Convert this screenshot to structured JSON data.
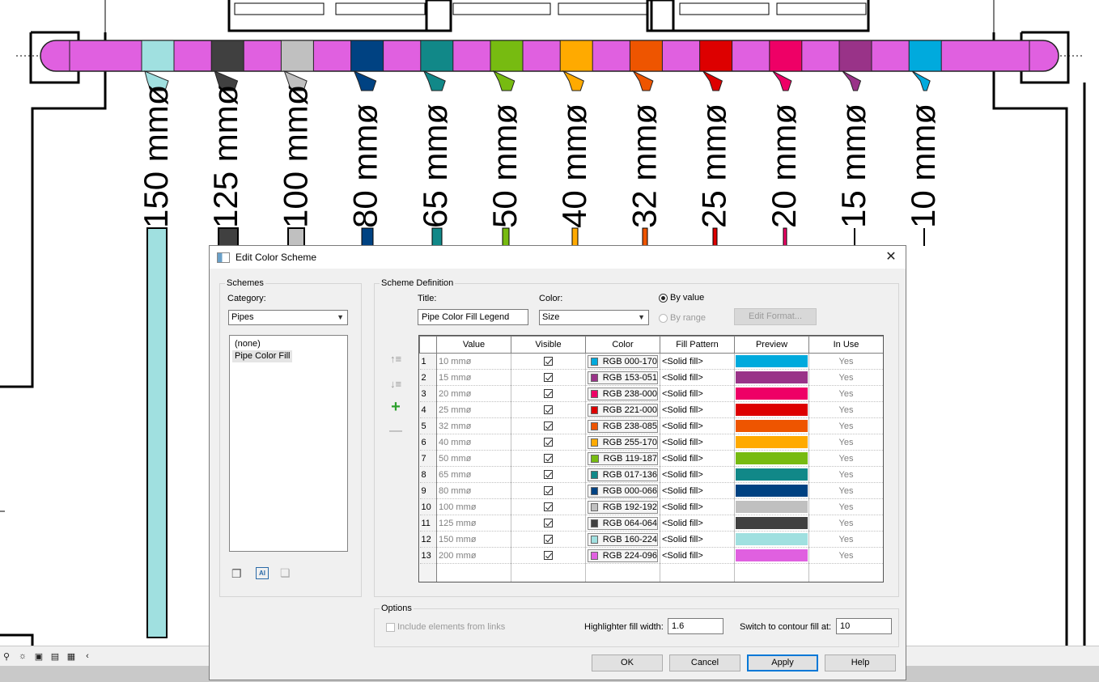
{
  "drawing": {
    "labels": [
      "150 mmø",
      "125 mmø",
      "100 mmø",
      "80 mmø",
      "65 mmø",
      "50 mmø",
      "40 mmø",
      "32 mmø",
      "25 mmø",
      "20 mmø",
      "15 mmø",
      "10 mmø"
    ],
    "swatches": [
      "#a0e0e0",
      "#404040",
      "#c0c0c0",
      "#004282",
      "#118888",
      "#77bb11",
      "#ffaa00",
      "#ee5500",
      "#dd0000",
      "#ee0066",
      "#993388",
      "#00aadd"
    ],
    "pipe_color": "#e060e0"
  },
  "dialog": {
    "title": "Edit Color Scheme",
    "close_glyph": "✕",
    "schemes": {
      "legend": "Schemes",
      "category_label": "Category:",
      "category_value": "Pipes",
      "items": [
        "(none)",
        "Pipe Color Fill"
      ],
      "selected_index": 1
    },
    "definition": {
      "legend": "Scheme Definition",
      "title_label": "Title:",
      "title_value": "Pipe Color Fill Legend",
      "color_label": "Color:",
      "color_value": "Size",
      "by_value": "By value",
      "by_range": "By range",
      "edit_format": "Edit Format...",
      "headers": [
        "Value",
        "Visible",
        "Color",
        "Fill Pattern",
        "Preview",
        "In Use"
      ],
      "rows": [
        {
          "n": "1",
          "value": "10 mmø",
          "color": "RGB 000-170",
          "hex": "#00aadd",
          "pattern": "<Solid fill>",
          "in_use": "Yes"
        },
        {
          "n": "2",
          "value": "15 mmø",
          "color": "RGB 153-051",
          "hex": "#993388",
          "pattern": "<Solid fill>",
          "in_use": "Yes"
        },
        {
          "n": "3",
          "value": "20 mmø",
          "color": "RGB 238-000",
          "hex": "#ee0066",
          "pattern": "<Solid fill>",
          "in_use": "Yes"
        },
        {
          "n": "4",
          "value": "25 mmø",
          "color": "RGB 221-000",
          "hex": "#dd0000",
          "pattern": "<Solid fill>",
          "in_use": "Yes"
        },
        {
          "n": "5",
          "value": "32 mmø",
          "color": "RGB 238-085",
          "hex": "#ee5500",
          "pattern": "<Solid fill>",
          "in_use": "Yes"
        },
        {
          "n": "6",
          "value": "40 mmø",
          "color": "RGB 255-170",
          "hex": "#ffaa00",
          "pattern": "<Solid fill>",
          "in_use": "Yes"
        },
        {
          "n": "7",
          "value": "50 mmø",
          "color": "RGB 119-187",
          "hex": "#77bb11",
          "pattern": "<Solid fill>",
          "in_use": "Yes"
        },
        {
          "n": "8",
          "value": "65 mmø",
          "color": "RGB 017-136",
          "hex": "#118888",
          "pattern": "<Solid fill>",
          "in_use": "Yes"
        },
        {
          "n": "9",
          "value": "80 mmø",
          "color": "RGB 000-066",
          "hex": "#004282",
          "pattern": "<Solid fill>",
          "in_use": "Yes"
        },
        {
          "n": "10",
          "value": "100 mmø",
          "color": "RGB 192-192",
          "hex": "#c0c0c0",
          "pattern": "<Solid fill>",
          "in_use": "Yes"
        },
        {
          "n": "11",
          "value": "125 mmø",
          "color": "RGB 064-064",
          "hex": "#404040",
          "pattern": "<Solid fill>",
          "in_use": "Yes"
        },
        {
          "n": "12",
          "value": "150 mmø",
          "color": "RGB 160-224",
          "hex": "#a0e0e0",
          "pattern": "<Solid fill>",
          "in_use": "Yes"
        },
        {
          "n": "13",
          "value": "200 mmø",
          "color": "RGB 224-096",
          "hex": "#e060e0",
          "pattern": "<Solid fill>",
          "in_use": "Yes"
        }
      ]
    },
    "options": {
      "legend": "Options",
      "include_links": "Include elements from links",
      "highlighter_label": "Highlighter fill width:",
      "highlighter_value": "1.6",
      "contour_label": "Switch to contour fill at:",
      "contour_value": "10"
    },
    "buttons": {
      "ok": "OK",
      "cancel": "Cancel",
      "apply": "Apply",
      "help": "Help"
    }
  }
}
